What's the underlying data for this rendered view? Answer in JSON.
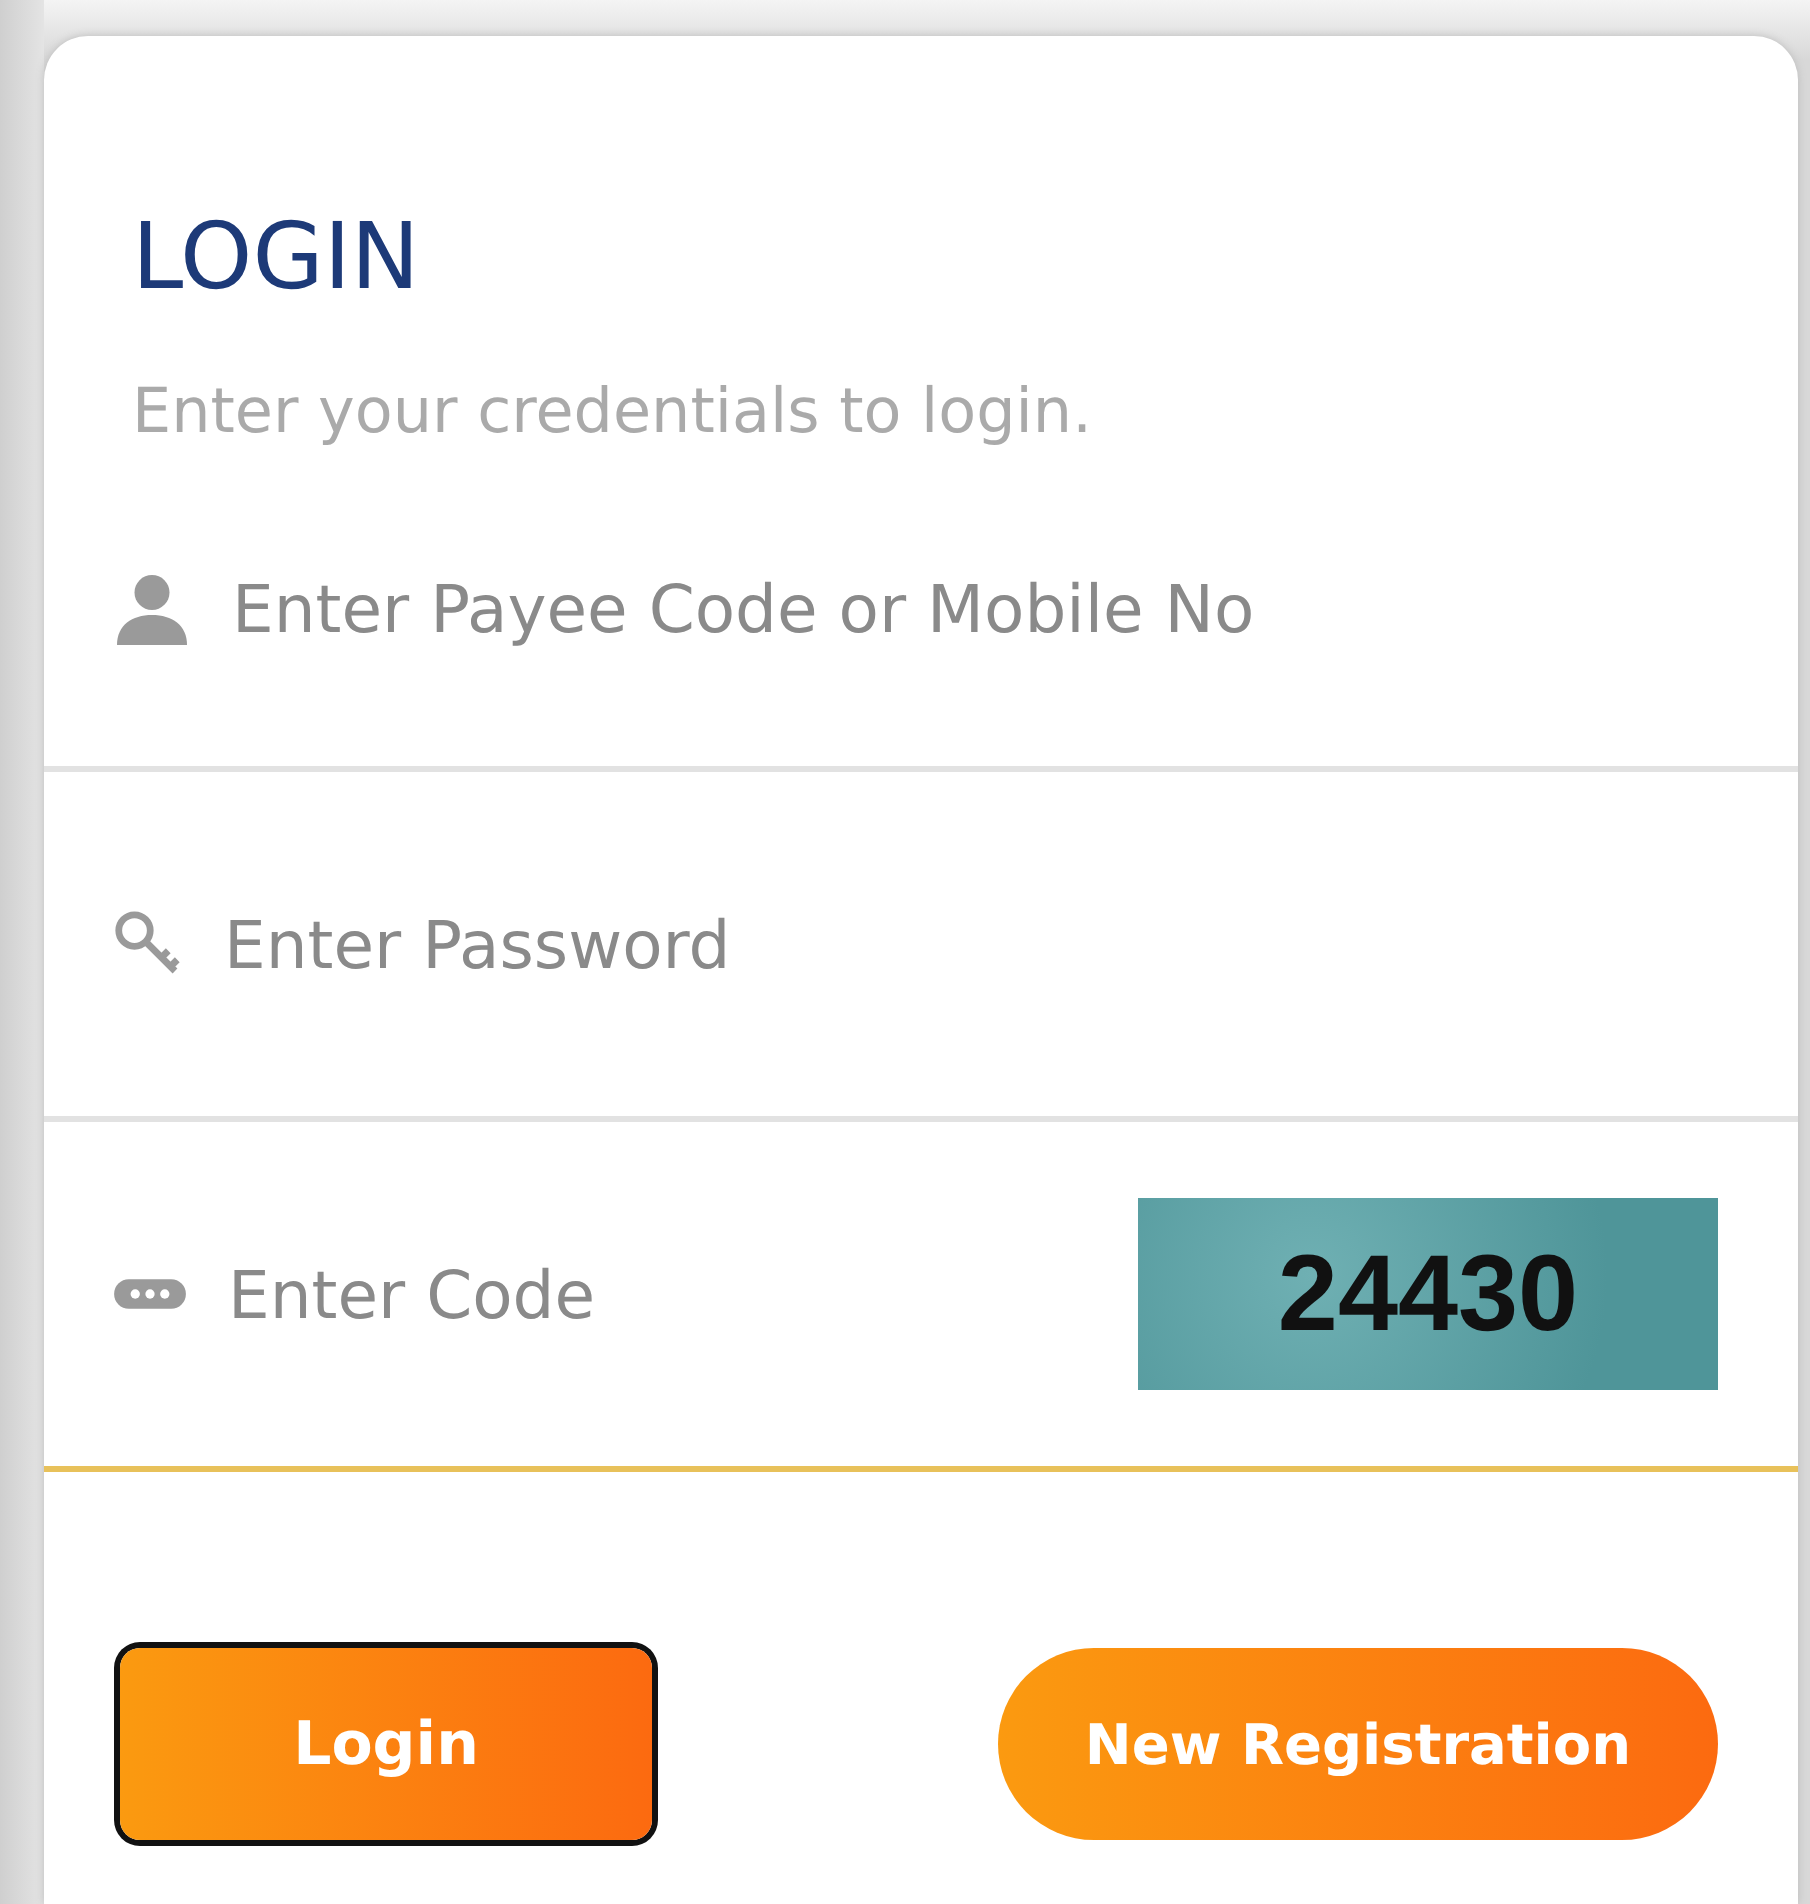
{
  "title": "LOGIN",
  "subtitle": "Enter your credentials to login.",
  "fields": [
    {
      "kind": "user",
      "placeholder": "Enter Payee Code or Mobile No",
      "focused": false
    },
    {
      "kind": "password",
      "placeholder": "Enter Password",
      "focused": false
    },
    {
      "kind": "code",
      "placeholder": "Enter Code",
      "focused": true,
      "captcha": "24430"
    }
  ],
  "buttons": [
    {
      "label": "Login",
      "focused": true
    },
    {
      "label": "New Registration",
      "focused": false
    }
  ]
}
